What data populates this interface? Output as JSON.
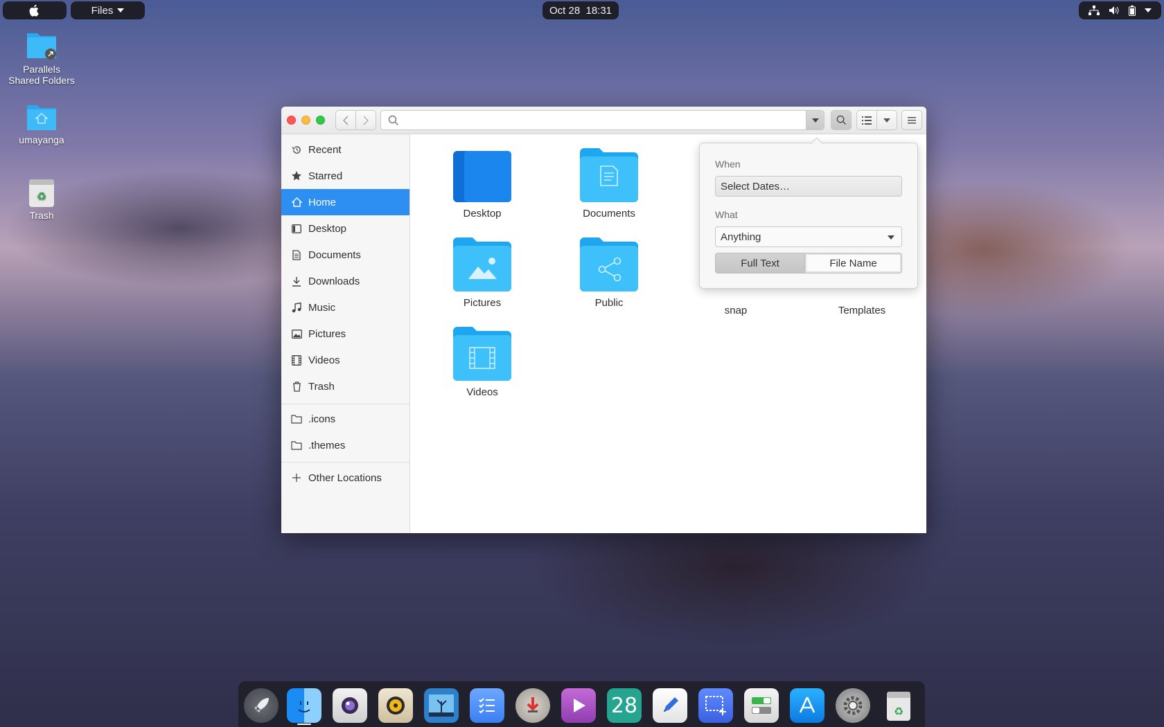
{
  "top_panel": {
    "apple_glyph": "",
    "app_menu_label": "Files",
    "clock": "Oct 28  18:31"
  },
  "desktop": {
    "items": [
      {
        "label": "Parallels\nShared Folders",
        "icon": "folder-link-icon"
      },
      {
        "label": "umayanga",
        "icon": "home-folder-icon"
      },
      {
        "label": "Trash",
        "icon": "trash-icon"
      }
    ]
  },
  "window": {
    "search_placeholder": "",
    "sidebar": [
      {
        "label": "Recent",
        "icon": "clock-icon"
      },
      {
        "label": "Starred",
        "icon": "star-icon"
      },
      {
        "label": "Home",
        "icon": "home-icon",
        "active": true
      },
      {
        "label": "Desktop",
        "icon": "desktop-icon"
      },
      {
        "label": "Documents",
        "icon": "document-icon"
      },
      {
        "label": "Downloads",
        "icon": "download-icon"
      },
      {
        "label": "Music",
        "icon": "music-icon"
      },
      {
        "label": "Pictures",
        "icon": "picture-icon"
      },
      {
        "label": "Videos",
        "icon": "film-icon"
      },
      {
        "label": "Trash",
        "icon": "trash-icon"
      },
      {
        "label": ".icons",
        "icon": "folder-icon"
      },
      {
        "label": ".themes",
        "icon": "folder-icon"
      },
      {
        "label": "Other Locations",
        "icon": "plus-icon"
      }
    ],
    "files": [
      {
        "name": "Desktop"
      },
      {
        "name": "Documents"
      },
      {
        "name": "Pictures"
      },
      {
        "name": "Public"
      },
      {
        "name": "snap"
      },
      {
        "name": "Templates"
      },
      {
        "name": "Videos"
      }
    ]
  },
  "search_popover": {
    "when_label": "When",
    "when_value": "Select Dates…",
    "what_label": "What",
    "what_value": "Anything",
    "seg_full_text": "Full Text",
    "seg_file_name": "File Name"
  },
  "dock": {
    "calendar_day": "28"
  },
  "colors": {
    "accent": "#2e8ff3",
    "folder": "#35b6f7",
    "panel": "#1e1f29"
  }
}
